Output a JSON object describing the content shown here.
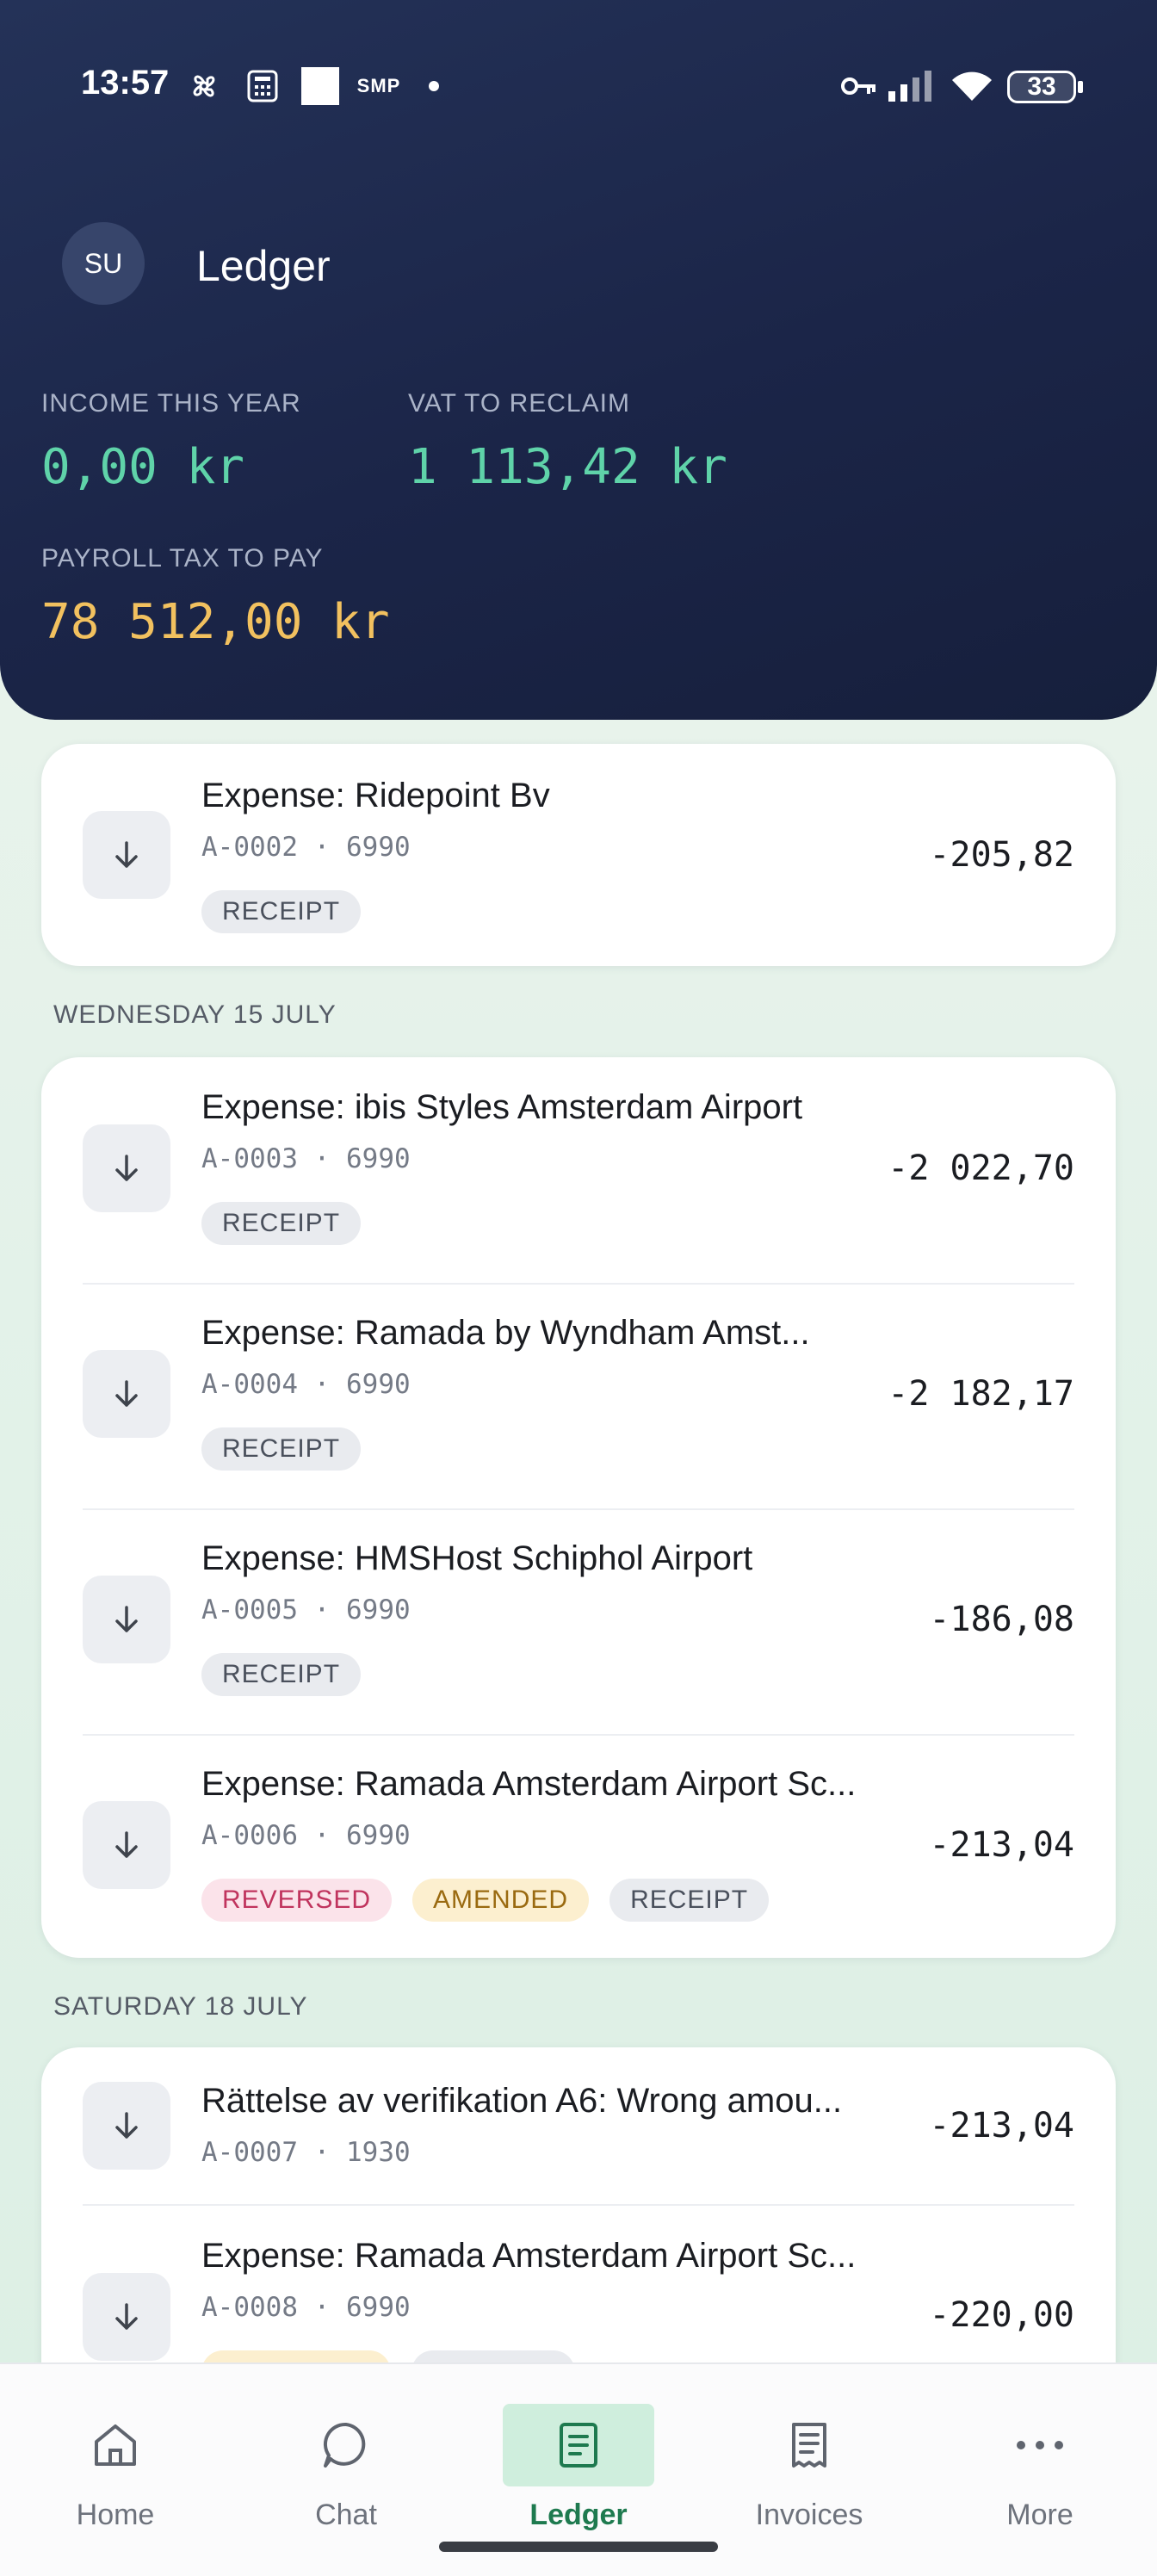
{
  "status_bar": {
    "time": "13:57",
    "smp": "SMP",
    "battery": "33"
  },
  "header": {
    "avatar_initials": "SU",
    "title": "Ledger",
    "stats": [
      {
        "label": "INCOME THIS YEAR",
        "value": "0,00 kr",
        "color": "#5fd3a9"
      },
      {
        "label": "VAT TO RECLAIM",
        "value": "1 113,42 kr",
        "color": "#5fd3a9"
      },
      {
        "label": "PAYROLL TAX TO PAY",
        "value": "78 512,00 kr",
        "color": "#f2c15f"
      }
    ]
  },
  "groups": [
    {
      "date": "",
      "entries": [
        {
          "title": "Expense: Ridepoint Bv",
          "ref": "A-0002",
          "account": "6990",
          "amount": "-205,82",
          "tags": [
            "RECEIPT"
          ]
        }
      ]
    },
    {
      "date": "WEDNESDAY 15 JULY",
      "entries": [
        {
          "title": "Expense: ibis Styles Amsterdam Airport",
          "ref": "A-0003",
          "account": "6990",
          "amount": "-2 022,70",
          "tags": [
            "RECEIPT"
          ]
        },
        {
          "title": "Expense: Ramada by Wyndham Amst...",
          "ref": "A-0004",
          "account": "6990",
          "amount": "-2 182,17",
          "tags": [
            "RECEIPT"
          ]
        },
        {
          "title": "Expense: HMSHost Schiphol Airport",
          "ref": "A-0005",
          "account": "6990",
          "amount": "-186,08",
          "tags": [
            "RECEIPT"
          ]
        },
        {
          "title": "Expense: Ramada Amsterdam Airport Sc...",
          "ref": "A-0006",
          "account": "6990",
          "amount": "-213,04",
          "tags": [
            "REVERSED",
            "AMENDED",
            "RECEIPT"
          ]
        }
      ]
    },
    {
      "date": "SATURDAY 18 JULY",
      "entries": [
        {
          "title": "Rättelse av verifikation A6: Wrong amou...",
          "ref": "A-0007",
          "account": "1930",
          "amount": "-213,04",
          "tags": []
        },
        {
          "title": "Expense: Ramada Amsterdam Airport Sc...",
          "ref": "A-0008",
          "account": "6990",
          "amount": "-220,00",
          "tags": []
        }
      ]
    }
  ],
  "separator": "·",
  "nav": {
    "items": [
      {
        "label": "Home",
        "icon": "home-icon"
      },
      {
        "label": "Chat",
        "icon": "chat-icon"
      },
      {
        "label": "Ledger",
        "icon": "ledger-icon",
        "active": true
      },
      {
        "label": "Invoices",
        "icon": "invoice-icon"
      },
      {
        "label": "More",
        "icon": "more-icon"
      }
    ]
  }
}
